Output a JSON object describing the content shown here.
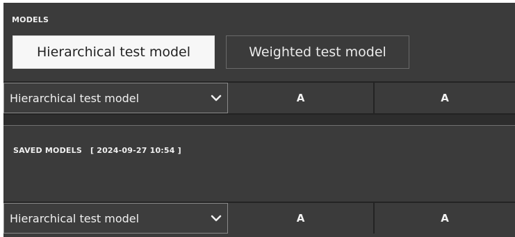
{
  "models": {
    "section_label": "MODELS",
    "tabs": [
      {
        "label": "Hierarchical test model",
        "selected": true
      },
      {
        "label": "Weighted test model",
        "selected": false
      }
    ]
  },
  "top_row": {
    "dropdown_value": "Hierarchical test model",
    "dropdown_icon": "chevron-down-icon",
    "cells": [
      "A",
      "A"
    ]
  },
  "saved_models": {
    "section_label": "SAVED MODELS",
    "timestamp": "[ 2024-09-27 10:54 ]"
  },
  "bottom_row": {
    "dropdown_value": "Hierarchical test model",
    "dropdown_icon": "chevron-down-icon",
    "cells": [
      "A",
      "A"
    ]
  },
  "colors": {
    "panel_background": "#3b3b3b",
    "active_tab_background": "#f7f7f7",
    "text": "#f0f0f0"
  }
}
